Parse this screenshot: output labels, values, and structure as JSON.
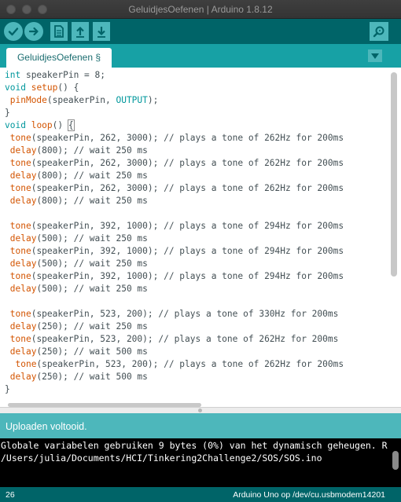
{
  "window": {
    "title": "GeluidjesOefenen | Arduino 1.8.12"
  },
  "toolbar": {
    "verify_icon": "checkmark-icon",
    "upload_icon": "arrow-right-icon",
    "new_icon": "file-icon",
    "open_icon": "arrow-up-icon",
    "save_icon": "arrow-down-icon",
    "serial_icon": "magnifier-icon"
  },
  "tabs": [
    {
      "label": "GeluidjesOefenen §"
    }
  ],
  "code_lines": [
    "int speakerPin = 8;",
    "void setup() {",
    " pinMode(speakerPin, OUTPUT);",
    "}",
    "void loop() {",
    " tone(speakerPin, 262, 3000); // plays a tone of 262Hz for 200ms",
    " delay(800); // wait 250 ms",
    " tone(speakerPin, 262, 3000); // plays a tone of 262Hz for 200ms",
    " delay(800); // wait 250 ms",
    " tone(speakerPin, 262, 3000); // plays a tone of 262Hz for 200ms",
    " delay(800); // wait 250 ms",
    "",
    " tone(speakerPin, 392, 1000); // plays a tone of 294Hz for 200ms",
    " delay(500); // wait 250 ms",
    " tone(speakerPin, 392, 1000); // plays a tone of 294Hz for 200ms",
    " delay(500); // wait 250 ms",
    " tone(speakerPin, 392, 1000); // plays a tone of 294Hz for 200ms",
    " delay(500); // wait 250 ms",
    "",
    " tone(speakerPin, 523, 200); // plays a tone of 330Hz for 200ms",
    " delay(250); // wait 250 ms",
    " tone(speakerPin, 523, 200); // plays a tone of 262Hz for 200ms",
    " delay(250); // wait 500 ms",
    "  tone(speakerPin, 523, 200); // plays a tone of 262Hz for 200ms",
    " delay(250); // wait 500 ms",
    "}"
  ],
  "status": {
    "message": "Uploaden voltooid."
  },
  "console": {
    "lines": [
      "Globale variabelen gebruiken 9 bytes (0%) van het dynamisch geheugen. R",
      "/Users/julia/Documents/HCI/Tinkering2Challenge2/SOS/SOS.ino"
    ]
  },
  "footer": {
    "line_number": "26",
    "board": "Arduino Uno op /dev/cu.usbmodem14201"
  }
}
